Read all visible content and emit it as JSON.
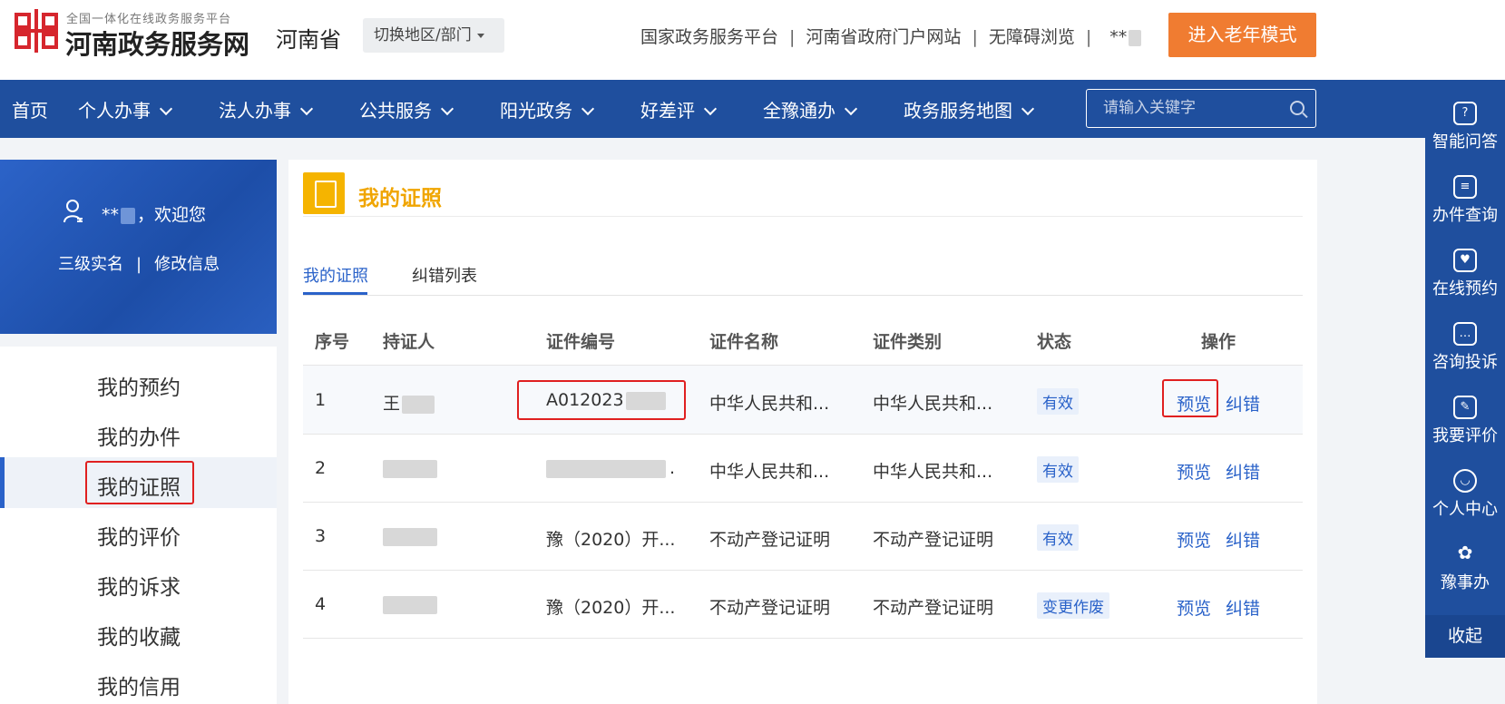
{
  "header": {
    "logo_subtitle": "全国一体化在线政务服务平台",
    "logo_title": "河南政务服务网",
    "province": "河南省",
    "switch_label": "切换地区/部门",
    "links": [
      "国家政务服务平台",
      "河南省政府门户网站",
      "无障碍浏览"
    ],
    "user_short": "**",
    "elder_mode": "进入老年模式"
  },
  "nav": {
    "items": [
      {
        "label": "首页",
        "dropdown": false
      },
      {
        "label": "个人办事",
        "dropdown": true
      },
      {
        "label": "法人办事",
        "dropdown": true
      },
      {
        "label": "公共服务",
        "dropdown": true
      },
      {
        "label": "阳光政务",
        "dropdown": true
      },
      {
        "label": "好差评",
        "dropdown": true
      },
      {
        "label": "全豫通办",
        "dropdown": true
      },
      {
        "label": "政务服务地图",
        "dropdown": true
      }
    ],
    "search_placeholder": "请输入关键字"
  },
  "right_bar": {
    "items": [
      "智能问答",
      "办件查询",
      "在线预约",
      "咨询投诉",
      "我要评价",
      "个人中心",
      "豫事办"
    ],
    "collapse": "收起"
  },
  "sidebar": {
    "welcome_name": "**",
    "welcome_text": "，欢迎您",
    "link_realname": "三级实名",
    "link_edit": "修改信息",
    "menu": [
      "我的预约",
      "我的办件",
      "我的证照",
      "我的评价",
      "我的诉求",
      "我的收藏",
      "我的信用"
    ],
    "active_index": 2
  },
  "main": {
    "title": "我的证照",
    "tabs": [
      "我的证照",
      "纠错列表"
    ],
    "columns": [
      "序号",
      "持证人",
      "证件编号",
      "证件名称",
      "证件类别",
      "状态",
      "操作"
    ],
    "rows": [
      {
        "no": "1",
        "holder": "王",
        "cert_no": "A012023",
        "name": "中华人民共和...",
        "category": "中华人民共和...",
        "status": "有效"
      },
      {
        "no": "2",
        "holder": "",
        "cert_no": ".",
        "name": "中华人民共和...",
        "category": "中华人民共和...",
        "status": "有效"
      },
      {
        "no": "3",
        "holder": "",
        "cert_no": "豫（2020）开...",
        "name": "不动产登记证明",
        "category": "不动产登记证明",
        "status": "有效"
      },
      {
        "no": "4",
        "holder": "",
        "cert_no": "豫（2020）开...",
        "name": "不动产登记证明",
        "category": "不动产登记证明",
        "status": "变更作废"
      }
    ],
    "op_preview": "预览",
    "op_correct": "纠错"
  },
  "colors": {
    "nav_blue": "#1f4f9e",
    "accent_orange": "#f07c31",
    "title_gold": "#f0a500",
    "link_blue": "#2a62c9",
    "highlight_red": "#e02020"
  }
}
